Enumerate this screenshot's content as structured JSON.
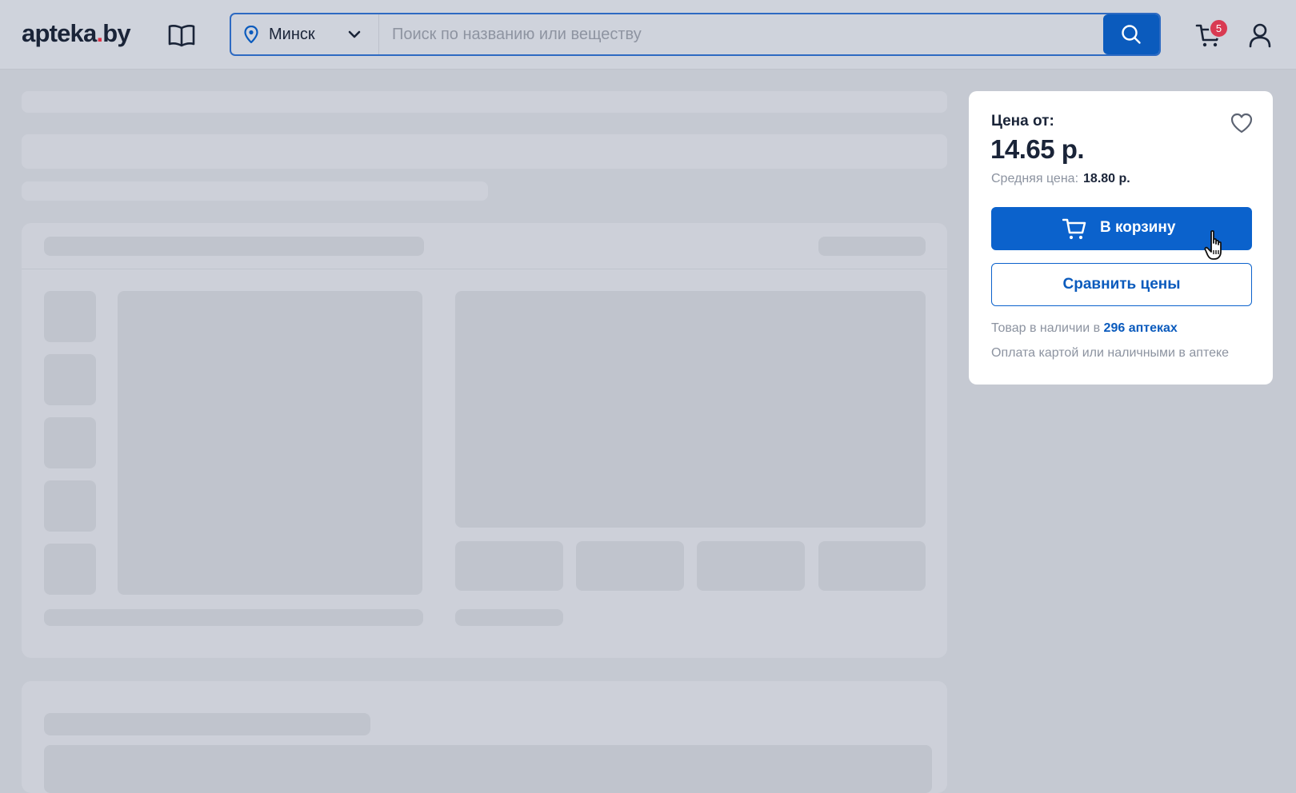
{
  "header": {
    "logo": {
      "prefix": "apteka",
      "dot": ".",
      "suffix": "by"
    },
    "city": "Минск",
    "search_placeholder": "Поиск по названию или веществу",
    "cart_count": "5",
    "icons": [
      "catalog-book-icon",
      "location-pin-icon",
      "chevron-down-icon",
      "search-icon",
      "cart-icon",
      "user-icon"
    ]
  },
  "price_panel": {
    "price_label": "Цена от:",
    "price": "14.65 р.",
    "avg_label": "Средняя цена:",
    "avg_value": "18.80 р.",
    "cart_button": "В корзину",
    "compare_button": "Сравнить цены",
    "stock_text": "Товар в наличии в",
    "stock_link": "296 аптеках",
    "payment_text": "Оплата картой или наличными в аптеке"
  },
  "colors": {
    "accent": "#0b62cc",
    "badge": "#d93a52",
    "text": "#1a2438",
    "muted": "#8c93a0",
    "background": "#c5c9d2"
  }
}
